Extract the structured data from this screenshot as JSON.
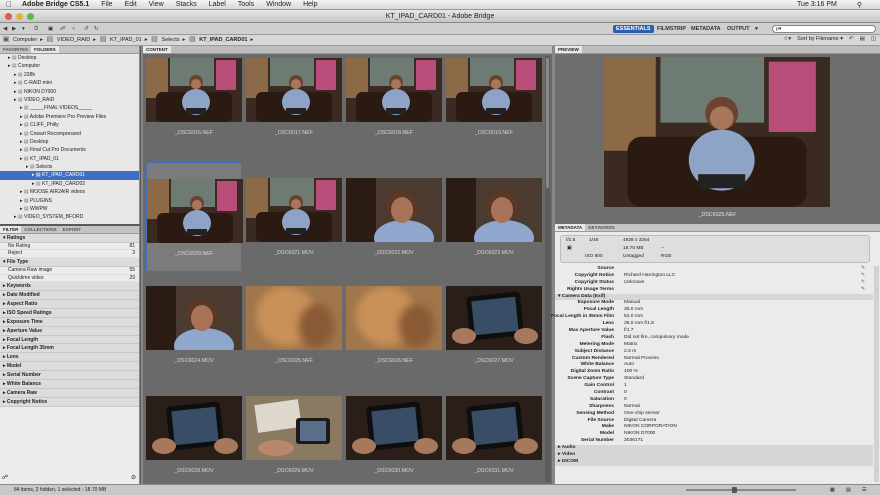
{
  "menubar": {
    "apple": "",
    "app": "Adobe Bridge CS5.1",
    "items": [
      "File",
      "Edit",
      "View",
      "Stacks",
      "Label",
      "Tools",
      "Window",
      "Help"
    ],
    "clock": "Tue 3:16 PM"
  },
  "window": {
    "title": "KT_IPAD_CARD01 - Adobe Bridge"
  },
  "workspaces": {
    "essentials": "ESSENTIALS",
    "filmstrip": "FILMSTRIP",
    "metadata": "METADATA",
    "output": "OUTPUT",
    "output_arrow": "▾"
  },
  "search": {
    "placeholder": "ρ▾"
  },
  "sort": {
    "label": "Sort by Filename ▾"
  },
  "path": [
    "Computer",
    "VIDEO_RAID",
    "KT_IPAD_01",
    "Selects",
    "KT_IPAD_CARD01"
  ],
  "left_tabs": [
    "FAVORITES",
    "FOLDERS"
  ],
  "folders": [
    {
      "label": "Desktop",
      "indent": 1
    },
    {
      "label": "Computer",
      "indent": 1
    },
    {
      "label": "238b",
      "indent": 2
    },
    {
      "label": "C-RAID mini",
      "indent": 2
    },
    {
      "label": "NIKON D7000",
      "indent": 2
    },
    {
      "label": "VIDEO_RAID",
      "indent": 2
    },
    {
      "label": "_____FINAL VIDEOS_____",
      "indent": 3
    },
    {
      "label": "Adobe Premiere Pro Preview Files",
      "indent": 3
    },
    {
      "label": "CLIFF_Philly",
      "indent": 3
    },
    {
      "label": "Cowart Recompressed",
      "indent": 3
    },
    {
      "label": "Desktop",
      "indent": 3
    },
    {
      "label": "Final Cut Pro Documents",
      "indent": 3
    },
    {
      "label": "KT_IPAD_01",
      "indent": 3
    },
    {
      "label": "Selects",
      "indent": 4
    },
    {
      "label": "KT_IPAD_CARD01",
      "indent": 5,
      "selected": true
    },
    {
      "label": "KT_IPAD_CARD02",
      "indent": 5
    },
    {
      "label": "MOOSE AIR2AIR videos",
      "indent": 3
    },
    {
      "label": "PLUGINS",
      "indent": 3
    },
    {
      "label": "WWPW",
      "indent": 3
    },
    {
      "label": "VIDEO_SYSTEM_BFORD",
      "indent": 2
    }
  ],
  "filter_tabs": [
    "FILTER",
    "COLLECTIONS",
    "EXPORT"
  ],
  "filters": {
    "ratings_head": "Ratings",
    "ratings": [
      {
        "label": "No Rating",
        "count": "81"
      },
      {
        "label": "Reject",
        "count": "3"
      }
    ],
    "filetype_head": "File Type",
    "filetypes": [
      {
        "label": "Camera Raw image",
        "count": "55"
      },
      {
        "label": "Quicktime video",
        "count": "29"
      }
    ],
    "sections": [
      "Keywords",
      "Date Modified",
      "Aspect Ratio",
      "ISO Speed Ratings",
      "Exposure Time",
      "Aperture Value",
      "Focal Length",
      "Focal Length 35mm",
      "Lens",
      "Model",
      "Serial Number",
      "White Balance",
      "Camera Raw",
      "Copyright Notice"
    ]
  },
  "content_tab": "CONTENT",
  "thumbs": [
    {
      "name": "_DSC6016.NEF",
      "kind": "photo"
    },
    {
      "name": "_DSC6017.NEF",
      "kind": "photo"
    },
    {
      "name": "_DSC6018.NEF",
      "kind": "photo"
    },
    {
      "name": "_DSC6019.NEF",
      "kind": "photo"
    },
    {
      "name": "_DSC6020.NEF",
      "kind": "photo",
      "selected": true
    },
    {
      "name": "_DSC6021.MOV",
      "kind": "photo"
    },
    {
      "name": "_DSC6022.MOV",
      "kind": "close"
    },
    {
      "name": "_DSC6023.MOV",
      "kind": "close"
    },
    {
      "name": "_DSC6024.MOV",
      "kind": "close"
    },
    {
      "name": "_DSC6025.NEF",
      "kind": "blur"
    },
    {
      "name": "_DSC6026.NEF",
      "kind": "blur"
    },
    {
      "name": "_DSC6027.MOV",
      "kind": "tablet"
    },
    {
      "name": "_DSC6028.MOV",
      "kind": "tablet"
    },
    {
      "name": "_DSC6029.MOV",
      "kind": "hands"
    },
    {
      "name": "_DSC6030.MOV",
      "kind": "tablet"
    },
    {
      "name": "_DSC6031.MOV",
      "kind": "tablet"
    }
  ],
  "preview": {
    "tab": "PREVIEW",
    "caption": "_DSC6025.NEF"
  },
  "meta_tabs": [
    "METADATA",
    "KEYWORDS"
  ],
  "meta_summary": {
    "aperture": "f/2.8",
    "shutter": "1/45",
    "iso_line": "ISO 800",
    "dims": "4928 x 3264",
    "size": "18.70 MB",
    "res": "--",
    "profile": "Untagged",
    "mode": "RGB"
  },
  "meta_rows_top": [
    {
      "k": "Source",
      "v": ""
    },
    {
      "k": "Copyright Notice",
      "v": "Richard Harrington LLC"
    },
    {
      "k": "Copyright Status",
      "v": "Unknown"
    },
    {
      "k": "Rights Usage Terms",
      "v": ""
    }
  ],
  "camera_head": "Camera Data (Exif)",
  "meta_rows": [
    {
      "k": "Exposure Mode",
      "v": "Manual"
    },
    {
      "k": "Focal Length",
      "v": "35.0 mm"
    },
    {
      "k": "Focal Length in 35mm Film",
      "v": "52.0 mm"
    },
    {
      "k": "Lens",
      "v": "35.0 mm f/1.8"
    },
    {
      "k": "Max Aperture Value",
      "v": "f/1.7"
    },
    {
      "k": "Flash",
      "v": "Did not fire, compulsory mode"
    },
    {
      "k": "Metering Mode",
      "v": "Matrix"
    },
    {
      "k": "Subject Distance",
      "v": "2.5 m"
    },
    {
      "k": "Custom Rendered",
      "v": "Normal Process"
    },
    {
      "k": "White Balance",
      "v": "Auto"
    },
    {
      "k": "Digital Zoom Ratio",
      "v": "100 %"
    },
    {
      "k": "Scene Capture Type",
      "v": "Standard"
    },
    {
      "k": "Gain Control",
      "v": "1"
    },
    {
      "k": "Contrast",
      "v": "0"
    },
    {
      "k": "Saturation",
      "v": "0"
    },
    {
      "k": "Sharpness",
      "v": "Normal"
    },
    {
      "k": "Sensing Method",
      "v": "One-chip sensor"
    },
    {
      "k": "File Source",
      "v": "Digital Camera"
    },
    {
      "k": "Make",
      "v": "NIKON CORPORATION"
    },
    {
      "k": "Model",
      "v": "NIKON D7000"
    },
    {
      "k": "Serial Number",
      "v": "3036171"
    }
  ],
  "meta_sections": [
    "Audio",
    "Video",
    "DICOM"
  ],
  "status": "84 items, 2 hidden, 1 selected - 18.70 MB"
}
